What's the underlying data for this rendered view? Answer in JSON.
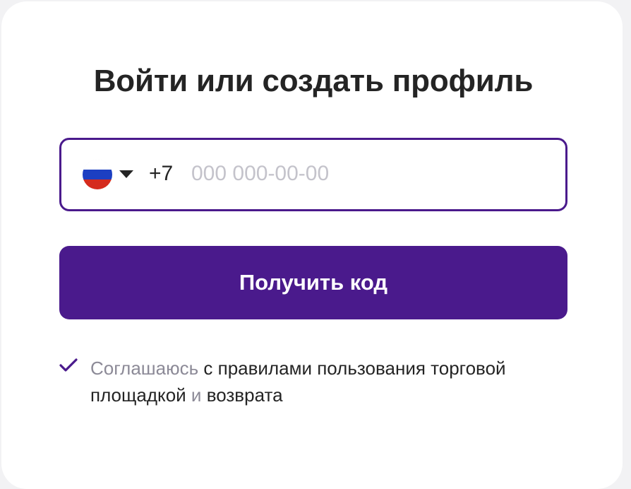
{
  "login": {
    "title": "Войти или создать профиль",
    "phone": {
      "country_code": "+7",
      "placeholder": "000 000-00-00",
      "value": "",
      "flag_icon": "russia-flag-icon",
      "flag_colors": [
        "#ffffff",
        "#1c3fc2",
        "#d52b1e"
      ]
    },
    "submit_label": "Получить код",
    "agreement": {
      "checked": true,
      "agree_word": "Соглашаюсь",
      "rules_link": "с правилами пользования торговой площадкой",
      "conjunction": "и",
      "returns_link": "возврата"
    }
  },
  "colors": {
    "accent": "#4a1a8c",
    "text": "#242424",
    "muted": "#8c8a97",
    "placeholder": "#c4c3cb",
    "background": "#f2f2f4"
  }
}
